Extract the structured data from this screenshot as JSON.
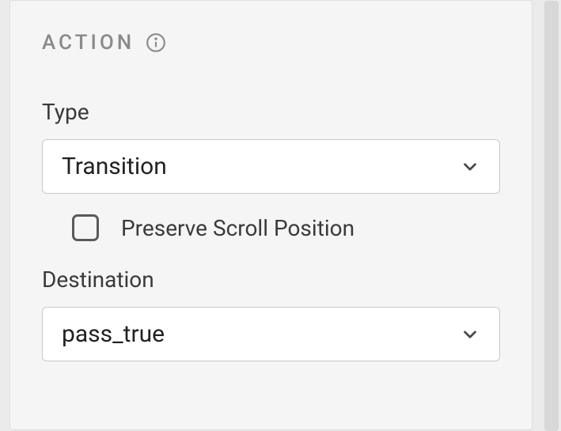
{
  "section": {
    "title": "ACTION"
  },
  "fields": {
    "type": {
      "label": "Type",
      "value": "Transition"
    },
    "preserve_scroll": {
      "label": "Preserve Scroll Position",
      "checked": false
    },
    "destination": {
      "label": "Destination",
      "value": "pass_true"
    }
  }
}
